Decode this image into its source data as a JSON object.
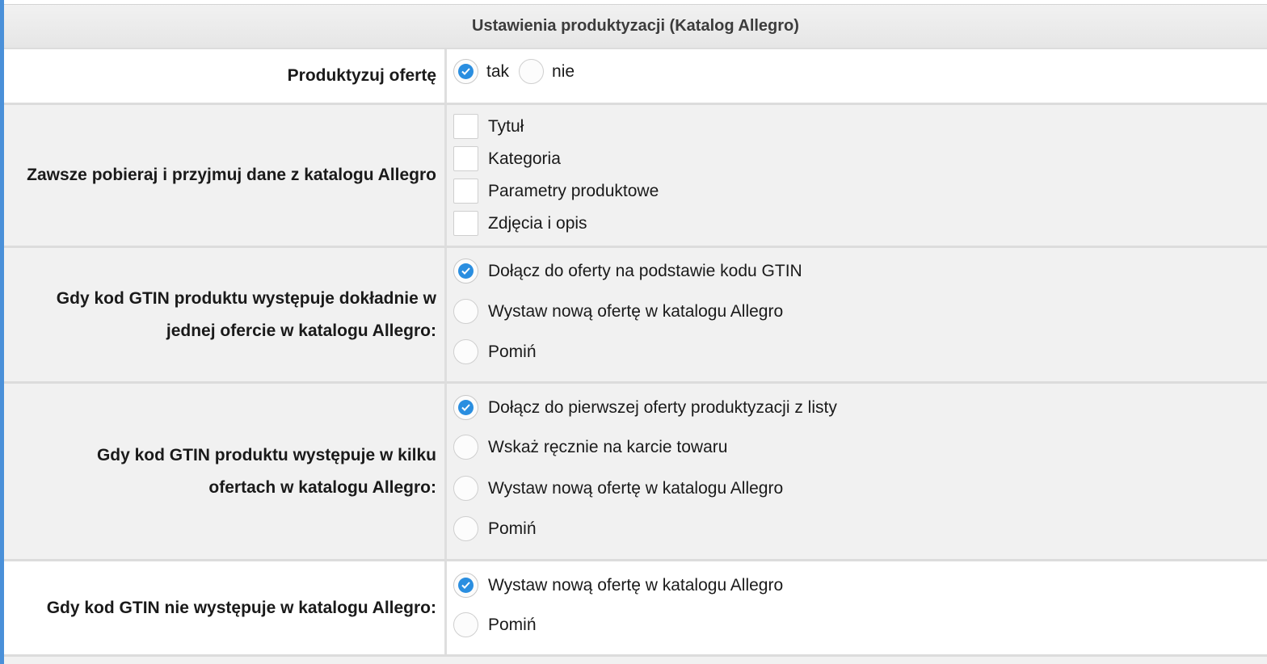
{
  "header": {
    "title": "Ustawienia produktyzacji (Katalog Allegro)"
  },
  "accent_color": "#2a8ee0",
  "rows": [
    {
      "label": "Produktyzuj ofertę",
      "options": [
        {
          "label": "tak",
          "checked": true
        },
        {
          "label": "nie",
          "checked": false
        }
      ]
    },
    {
      "label": "Zawsze pobieraj i przyjmuj dane z katalogu Allegro",
      "options": [
        {
          "label": "Tytuł",
          "checked": false
        },
        {
          "label": "Kategoria",
          "checked": false
        },
        {
          "label": "Parametry produktowe",
          "checked": false
        },
        {
          "label": "Zdjęcia i opis",
          "checked": false
        }
      ]
    },
    {
      "label": "Gdy kod GTIN produktu występuje dokładnie w jednej ofercie w katalogu Allegro:",
      "options": [
        {
          "label": "Dołącz do oferty na podstawie kodu GTIN",
          "checked": true
        },
        {
          "label": "Wystaw nową ofertę w katalogu Allegro",
          "checked": false
        },
        {
          "label": "Pomiń",
          "checked": false
        }
      ]
    },
    {
      "label": "Gdy kod GTIN produktu występuje w kilku ofertach w katalogu Allegro:",
      "options": [
        {
          "label": "Dołącz do pierwszej oferty produktyzacji z listy",
          "checked": true
        },
        {
          "label": "Wskaż ręcznie na karcie towaru",
          "checked": false
        },
        {
          "label": "Wystaw nową ofertę w katalogu Allegro",
          "checked": false
        },
        {
          "label": "Pomiń",
          "checked": false
        }
      ]
    },
    {
      "label": "Gdy kod GTIN nie występuje w katalogu Allegro:",
      "options": [
        {
          "label": "Wystaw nową ofertę w katalogu Allegro",
          "checked": true
        },
        {
          "label": "Pomiń",
          "checked": false
        }
      ]
    }
  ]
}
